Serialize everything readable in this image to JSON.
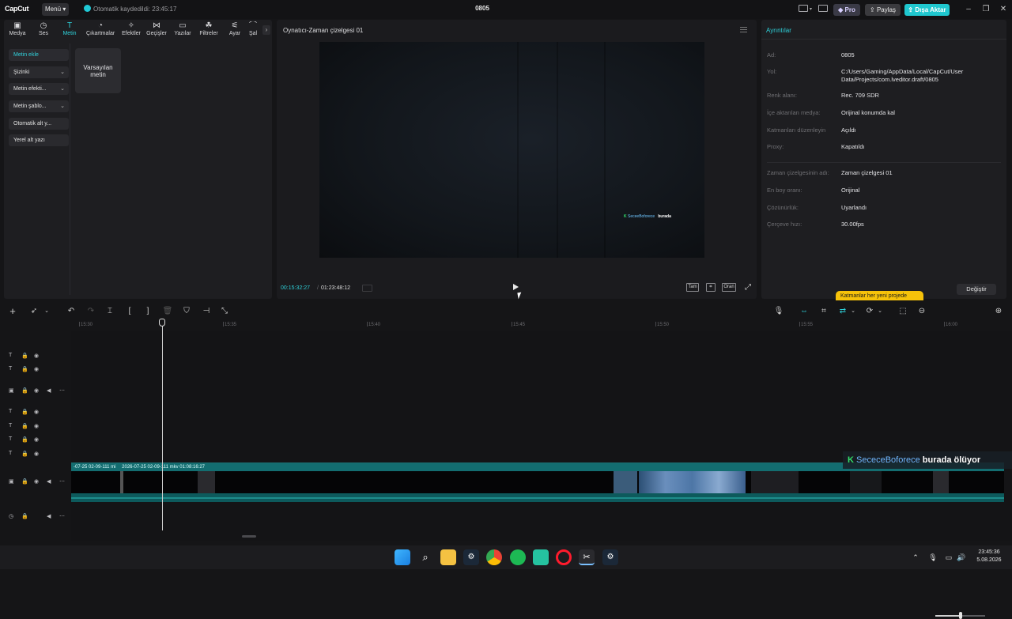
{
  "titlebar": {
    "logo": "CapCut",
    "menu_label": "Menü",
    "autosave_text": "Otomatik kaydedildi: 23:45:17",
    "project_title": "0805",
    "pro_label": "Pro",
    "share_label": "Paylaş",
    "export_label": "Dışa Aktar"
  },
  "tabs": [
    {
      "label": "Medya",
      "icon": "media-icon"
    },
    {
      "label": "Ses",
      "icon": "audio-icon"
    },
    {
      "label": "Metin",
      "icon": "text-icon"
    },
    {
      "label": "Çıkartmalar",
      "icon": "sticker-icon"
    },
    {
      "label": "Efektler",
      "icon": "effects-icon"
    },
    {
      "label": "Geçişler",
      "icon": "transitions-icon"
    },
    {
      "label": "Yazılar",
      "icon": "captions-icon"
    },
    {
      "label": "Filtreler",
      "icon": "filters-icon"
    },
    {
      "label": "Ayar",
      "icon": "adjust-icon"
    },
    {
      "label": "Şal",
      "icon": "more-icon"
    }
  ],
  "text_panel": {
    "subnav": [
      {
        "label": "Metin ekle"
      },
      {
        "label": "Şizinki"
      },
      {
        "label": "Metin efekti..."
      },
      {
        "label": "Metin şablo..."
      },
      {
        "label": "Otomatik alt y..."
      },
      {
        "label": "Yerel alt yazı"
      }
    ],
    "preset_label": "Varsayılan metin"
  },
  "player": {
    "title": "Oynatıcı-Zaman çizelgesi 01",
    "current_time": "00:15:32:27",
    "total_time": "01:23:48:12",
    "fit_label": "Tam",
    "ratio_label": "Oran",
    "watermark_name": "SeceeBoforece",
    "watermark_tag": "burada"
  },
  "details": {
    "title": "Ayrıntılar",
    "rows": [
      {
        "label": "Ad:",
        "value": "0805"
      },
      {
        "label": "Yol:",
        "value": "C:/Users/Gaming/AppData/Local/CapCut/User Data/Projects/com.lveditor.draft/0805"
      },
      {
        "label": "Renk alanı:",
        "value": "Rec. 709 SDR"
      },
      {
        "label": "İçe aktarılan medya:",
        "value": "Orijinal konumda kal"
      },
      {
        "label": "Katmanları düzenleyin",
        "value": "Açıldı"
      },
      {
        "label": "Proxy:",
        "value": "Kapatıldı"
      },
      {
        "label": "Zaman çizelgesinin adı:",
        "value": "Zaman çizelgesi 01"
      },
      {
        "label": "En boy oranı:",
        "value": "Orijinal"
      },
      {
        "label": "Çözünürlük:",
        "value": "Uyarlandı"
      },
      {
        "label": "Çerçeve hızı:",
        "value": "30.00fps"
      }
    ],
    "layer_tip": "Katmanlar her yeni projede",
    "change_label": "Değiştir"
  },
  "timeline": {
    "ruler": [
      "15:30",
      "15:35",
      "15:40",
      "15:45",
      "15:50",
      "15:55",
      "16:00"
    ],
    "clip_label": "2026-07-25 02-09-111 mkv   01:08:16:27",
    "clip_label_prefix": "-07-25 02-09-111 mi",
    "overlay_name": "SececeBoforece",
    "overlay_text": "burada ölüyor"
  },
  "taskbar": {
    "time": "23:45:36",
    "date": "5.08.2026"
  }
}
